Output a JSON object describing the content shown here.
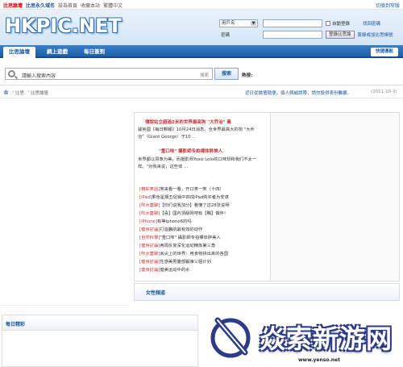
{
  "topbar": {
    "links": [
      "比思論壇",
      "比思永久域名",
      "設為首頁",
      "收藏本站",
      "繁體中文"
    ],
    "right": "切換到窄版"
  },
  "header": {
    "logo": "HKPIC.NET",
    "login": {
      "account_type": "用戶名",
      "auto_login": "自動登錄",
      "password_label": "密碼",
      "login_button": "登錄比思論",
      "forgot_password": "找回密碼",
      "register": "簽錄或加比思帳號"
    }
  },
  "nav": {
    "tabs": [
      "比思論壇",
      "網上遊戲",
      "每日簽到"
    ],
    "quick": "快捷導航"
  },
  "search": {
    "placeholder": "請輸入搜索內容",
    "type": "搜索",
    "button": "搜索",
    "hot_label": "熱搜:"
  },
  "breadcrumb": {
    "items": [
      "比思",
      "比思論壇"
    ],
    "notice": "近日從論壇隨便，個人佩誠請帶，請勿設得表份雖嚴。",
    "date": "(2011-10-3)"
  },
  "article": {
    "headline1": "傳說站立超過2米的世界最高狗 \"大乔治\" 离",
    "para1": "據英國《每日郵報》10月24日消息，全世界最高大的狗 \"大乔治\"（Giant George）于10 ...",
    "headline2": "\"重口味\" 攝影師专拍裸体胖美人",
    "para2": "世界都以原象为美，而摄影师Yossi Lolo的口味却和我们不太一样。\"对我来说，这些体 ...",
    "list": [
      {
        "tag": "[精彩笑話]",
        "text": "笑来看一看，开口笑一笑（十四）"
      },
      {
        "tag": "[iPad]",
        "text": "果色星期五促销中四成iPad购买者为安卓"
      },
      {
        "tag": "[吹水蓋聊]",
        "text": "【你们说我加分】看懂了这28张说明"
      },
      {
        "tag": "[吹水蓋聊]",
        "text": "【喜】國內頂級网吧有【鴨】做伴！"
      },
      {
        "tag": "[iPhone]",
        "text": "有等iphone6的吗"
      },
      {
        "tag": "[健身討論]",
        "text": "打造鵬肌最有效的动作"
      },
      {
        "tag": "[自然科學]",
        "text": "\"重口味\" 攝影師专拍裸体胖美人"
      },
      {
        "tag": "[健身討論]",
        "text": "两周反复深化运动精炼第三角"
      },
      {
        "tag": "[吹水蓋聊]",
        "text": "丟尖上的世界：用食物拼出來的各国"
      },
      {
        "tag": "[健身討論]",
        "text": "性感美男腹部鍛煉三個计划"
      },
      {
        "tag": "[健身討論]",
        "text": "健美运动中的水"
      }
    ]
  },
  "sections": {
    "video": "女性頻道",
    "daily": "每日精彩"
  },
  "watermark": {
    "text": "焱索新游网",
    "url": "www.yenso.net"
  },
  "colors": {
    "nav_blue": "#1f5ea8",
    "link_blue": "#1a55a5",
    "tag_red": "#cc3333"
  }
}
